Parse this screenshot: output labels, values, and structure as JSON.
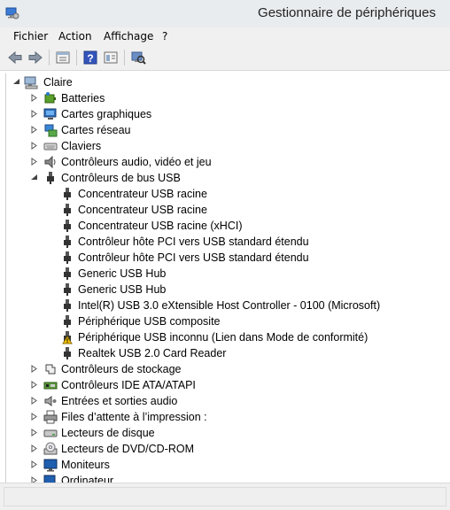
{
  "window": {
    "title": "Gestionnaire de périphériques"
  },
  "menu": {
    "items": [
      "Fichier",
      "Action",
      "Affichage",
      "?"
    ]
  },
  "toolbar": {
    "buttons": [
      "back-icon",
      "forward-icon",
      "properties-icon",
      "help-icon",
      "view-icon",
      "scan-hardware-icon"
    ]
  },
  "tree": {
    "root": "Claire",
    "categories_before": [
      {
        "label": "Batteries",
        "icon": "battery-icon"
      },
      {
        "label": "Cartes graphiques",
        "icon": "display-adapter-icon"
      },
      {
        "label": "Cartes réseau",
        "icon": "network-adapter-icon"
      },
      {
        "label": "Claviers",
        "icon": "keyboard-icon"
      },
      {
        "label": "Contrôleurs audio, vidéo et jeu",
        "icon": "speaker-icon"
      }
    ],
    "usb_category": "Contrôleurs de bus USB",
    "usb_devices": [
      {
        "label": "Concentrateur USB racine",
        "warning": false
      },
      {
        "label": "Concentrateur USB racine",
        "warning": false
      },
      {
        "label": "Concentrateur USB racine (xHCI)",
        "warning": false
      },
      {
        "label": "Contrôleur hôte PCI vers USB standard étendu",
        "warning": false
      },
      {
        "label": "Contrôleur hôte PCI vers USB standard étendu",
        "warning": false
      },
      {
        "label": "Generic USB Hub",
        "warning": false
      },
      {
        "label": "Generic USB Hub",
        "warning": false
      },
      {
        "label": "Intel(R) USB 3.0 eXtensible Host Controller - 0100 (Microsoft)",
        "warning": false
      },
      {
        "label": "Périphérique USB composite",
        "warning": false
      },
      {
        "label": "Périphérique USB inconnu (Lien dans Mode de conformité)",
        "warning": true
      },
      {
        "label": "Realtek USB 2.0 Card Reader",
        "warning": false
      }
    ],
    "categories_after": [
      {
        "label": "Contrôleurs de stockage",
        "icon": "storage-controller-icon"
      },
      {
        "label": "Contrôleurs IDE ATA/ATAPI",
        "icon": "ide-controller-icon"
      },
      {
        "label": "Entrées et sorties audio",
        "icon": "audio-io-icon"
      },
      {
        "label": "Files d’attente à l’impression :",
        "icon": "printer-icon"
      },
      {
        "label": "Lecteurs de disque",
        "icon": "disk-drive-icon"
      },
      {
        "label": "Lecteurs de DVD/CD-ROM",
        "icon": "dvd-drive-icon"
      },
      {
        "label": "Moniteurs",
        "icon": "monitor-icon"
      },
      {
        "label": "Ordinateur",
        "icon": "computer-icon"
      }
    ]
  }
}
